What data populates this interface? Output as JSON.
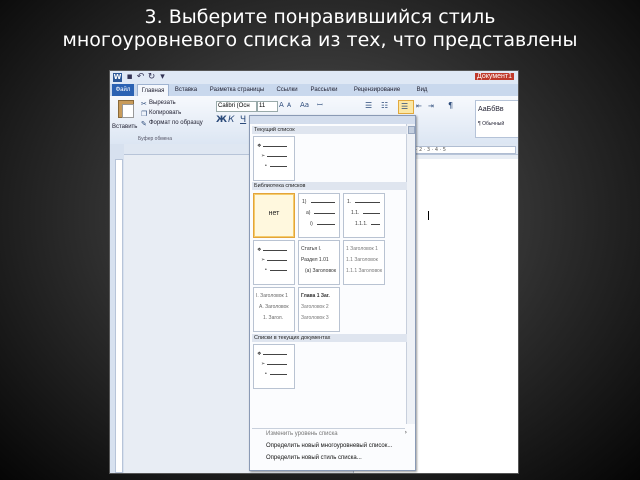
{
  "slide": {
    "title_line1": "3. Выберите понравившийся стиль",
    "title_line2": "многоуровневого списка из тех, что представлены"
  },
  "window": {
    "document_title": "Документ1"
  },
  "ribbon_tabs": [
    "Файл",
    "Главная",
    "Вставка",
    "Разметка страницы",
    "Ссылки",
    "Рассылки",
    "Рецензирование",
    "Вид"
  ],
  "ribbon": {
    "paste_label": "Вставить",
    "cut_label": "Вырезать",
    "copy_label": "Копировать",
    "format_painter_label": "Формат по образцу",
    "clipboard_group_label": "Буфер обмена",
    "font_name": "Calibri (Осн",
    "font_size": "11",
    "style_normal": "АаБбВв",
    "style_normal_name": "¶ Обычный"
  },
  "list_dropdown": {
    "section_current": "Текущий список",
    "section_library": "Библиотека списков",
    "section_document": "Списки в текущих документах",
    "none_label": "нет",
    "tile_numbered": [
      "1)",
      "a)",
      "i)"
    ],
    "tile_decimal": [
      "1.",
      "1.1.",
      "1.1.1."
    ],
    "tile_article": [
      "Статья I.",
      "Раздел 1.01",
      "(a) Заголовок"
    ],
    "tile_heading_decimal": [
      "1 Заголовок 1",
      "1.1 Заголовок",
      "1.1.1 Заголовок"
    ],
    "tile_heading_roman": [
      "I. Заголовок 1",
      "A. Заголовок",
      "1. Загол."
    ],
    "tile_chapter": [
      "Глава 1 Заг.",
      "Заголовок 2",
      "Заголовок 3"
    ],
    "cmd_change_level": "Изменить уровень списка",
    "cmd_define_new_list": "Определить новый многоуровневый список...",
    "cmd_define_new_style": "Определить новый стиль списка..."
  },
  "ruler_ticks": "1 · 2 · 3 · 4 · 5"
}
